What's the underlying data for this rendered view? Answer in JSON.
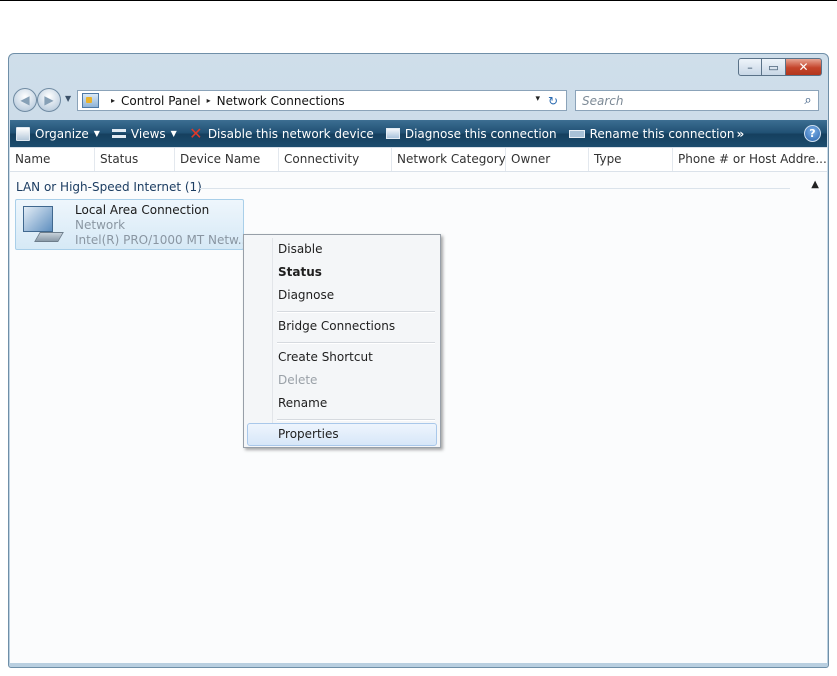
{
  "window": {
    "controls": {
      "minimize": "–",
      "maximize": "▭",
      "close": "✕"
    }
  },
  "address_bar": {
    "breadcrumbs": [
      "Control Panel",
      "Network Connections"
    ],
    "separator": "▸",
    "dropdown_glyph": "▾",
    "refresh_glyph": "↻"
  },
  "search": {
    "placeholder": "Search",
    "value": ""
  },
  "toolbar": {
    "organize": "Organize",
    "views": "Views",
    "disable": "Disable this network device",
    "diagnose": "Diagnose this connection",
    "rename": "Rename this connection",
    "more": "»",
    "help": "?"
  },
  "columns": [
    "Name",
    "Status",
    "Device Name",
    "Connectivity",
    "Network Category",
    "Owner",
    "Type",
    "Phone # or Host Addre..."
  ],
  "group": {
    "label": "LAN or High-Speed Internet (1)",
    "collapse_glyph": "▲"
  },
  "connection": {
    "name": "Local Area Connection",
    "status": "Network",
    "device": "Intel(R) PRO/1000 MT Netw..."
  },
  "context_menu": {
    "items": [
      "Disable",
      "Status",
      "Diagnose",
      "Bridge Connections",
      "Create Shortcut",
      "Delete",
      "Rename",
      "Properties"
    ]
  },
  "colors": {
    "toolbar": "#1f4f72",
    "selection": "#d6e9f6",
    "close_button": "#c4442a"
  }
}
